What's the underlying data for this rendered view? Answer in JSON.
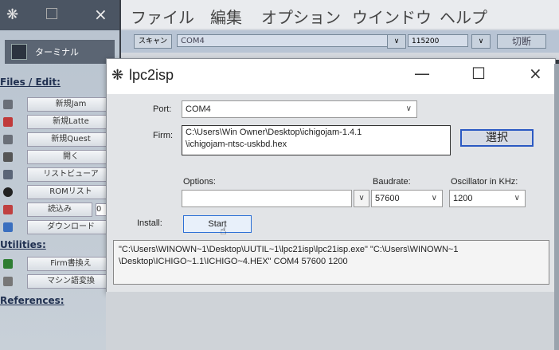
{
  "left_app": {
    "title_icon": "snowflake-icon",
    "close_glyph": "×",
    "terminal_label": "ターミナル",
    "files_heading": "Files / Edit:",
    "items": [
      {
        "label": "新規Jam",
        "icon_color": "#6a6f78"
      },
      {
        "label": "新規Latte",
        "icon_color": "#c03a3a"
      },
      {
        "label": "新規Quest",
        "icon_color": "#6a6f78"
      },
      {
        "label": "開く",
        "icon_color": "#555"
      },
      {
        "label": "リストビューア",
        "icon_color": "#5a6577"
      },
      {
        "label": "ROMリスト",
        "icon_color": "#222"
      },
      {
        "label": "読込み",
        "extra": "0",
        "icon_color": "#c04040"
      },
      {
        "label": "ダウンロード",
        "icon_color": "#3a6fbf"
      }
    ],
    "utilities_heading": "Utilities:",
    "utilities": [
      {
        "label": "Firm書換え",
        "icon_color": "#2e7d32"
      },
      {
        "label": "マシン語変換",
        "icon_color": "#777"
      }
    ],
    "references_heading": "References:"
  },
  "top_app": {
    "menu": [
      "ファイル",
      "編集",
      "オプション",
      "ウインドウ",
      "ヘルプ"
    ],
    "scan_label": "スキャン",
    "port_value": "COM4",
    "baud_value": "115200",
    "cut_label": "切断",
    "dd_glyph": "∨"
  },
  "dialog": {
    "title": "lpc2isp",
    "min_glyph": "—",
    "max_glyph": "☐",
    "close_glyph": "×",
    "port_label": "Port:",
    "port_value": "COM4",
    "firm_label": "Firm:",
    "firm_path_line1": "C:\\Users\\Win Owner\\Desktop\\ichigojam-1.4.1",
    "firm_path_line2": "\\ichigojam-ntsc-uskbd.hex",
    "select_label": "選択",
    "options_label": "Options:",
    "options_value": "",
    "baudrate_label": "Baudrate:",
    "baudrate_value": "57600",
    "oscillator_label": "Oscillator in KHz:",
    "oscillator_value": "1200",
    "install_label": "Install:",
    "start_label": "Start",
    "dd_glyph": "∨",
    "command_line1": "\"C:\\Users\\WINOWN~1\\Desktop\\UUTIL~1\\lpc21isp\\lpc21isp.exe\"  \"C:\\Users\\WINOWN~1",
    "command_line2": "\\Desktop\\ICHIGO~1.1\\ICHIGO~4.HEX\" COM4 57600 1200"
  }
}
